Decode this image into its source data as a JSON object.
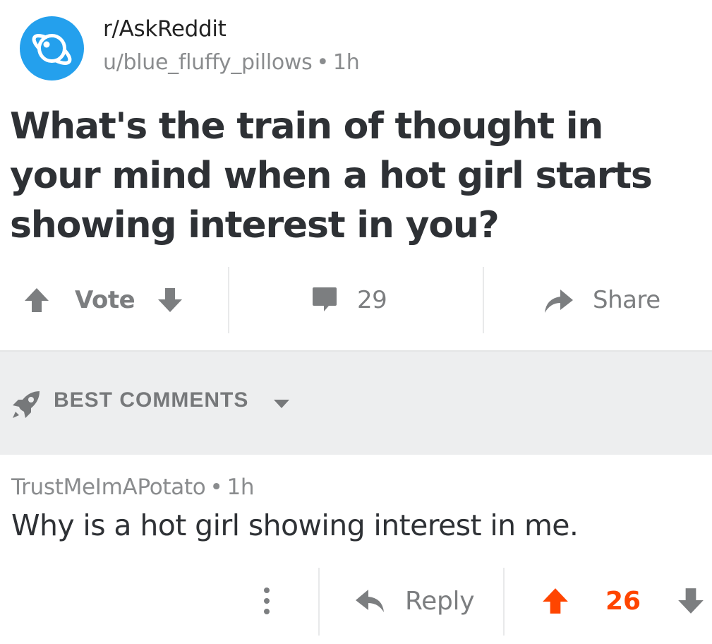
{
  "post": {
    "subreddit": "r/AskReddit",
    "author": "u/blue_fluffy_pillows",
    "separator": "•",
    "age": "1h",
    "title": "What's the train of thought in your mind when a hot girl starts showing interest in you?"
  },
  "actions": {
    "vote_label": "Vote",
    "comment_count": "29",
    "share_label": "Share"
  },
  "sort": {
    "label": "BEST COMMENTS"
  },
  "comment": {
    "author": "TrustMeImAPotato",
    "separator": "•",
    "age": "1h",
    "body": "Why is a hot girl showing interest in me.",
    "reply_label": "Reply",
    "score": "26",
    "score_state": "upvoted"
  },
  "colors": {
    "avatar": "#24a0ed",
    "upvote_active": "#ff4500",
    "muted": "#7c7e80",
    "sort_background": "#edeeef"
  },
  "icons": [
    "planet-icon",
    "upvote-icon",
    "downvote-icon",
    "comment-icon",
    "share-icon",
    "rocket-icon",
    "chevron-down-icon",
    "more-icon",
    "reply-icon"
  ]
}
